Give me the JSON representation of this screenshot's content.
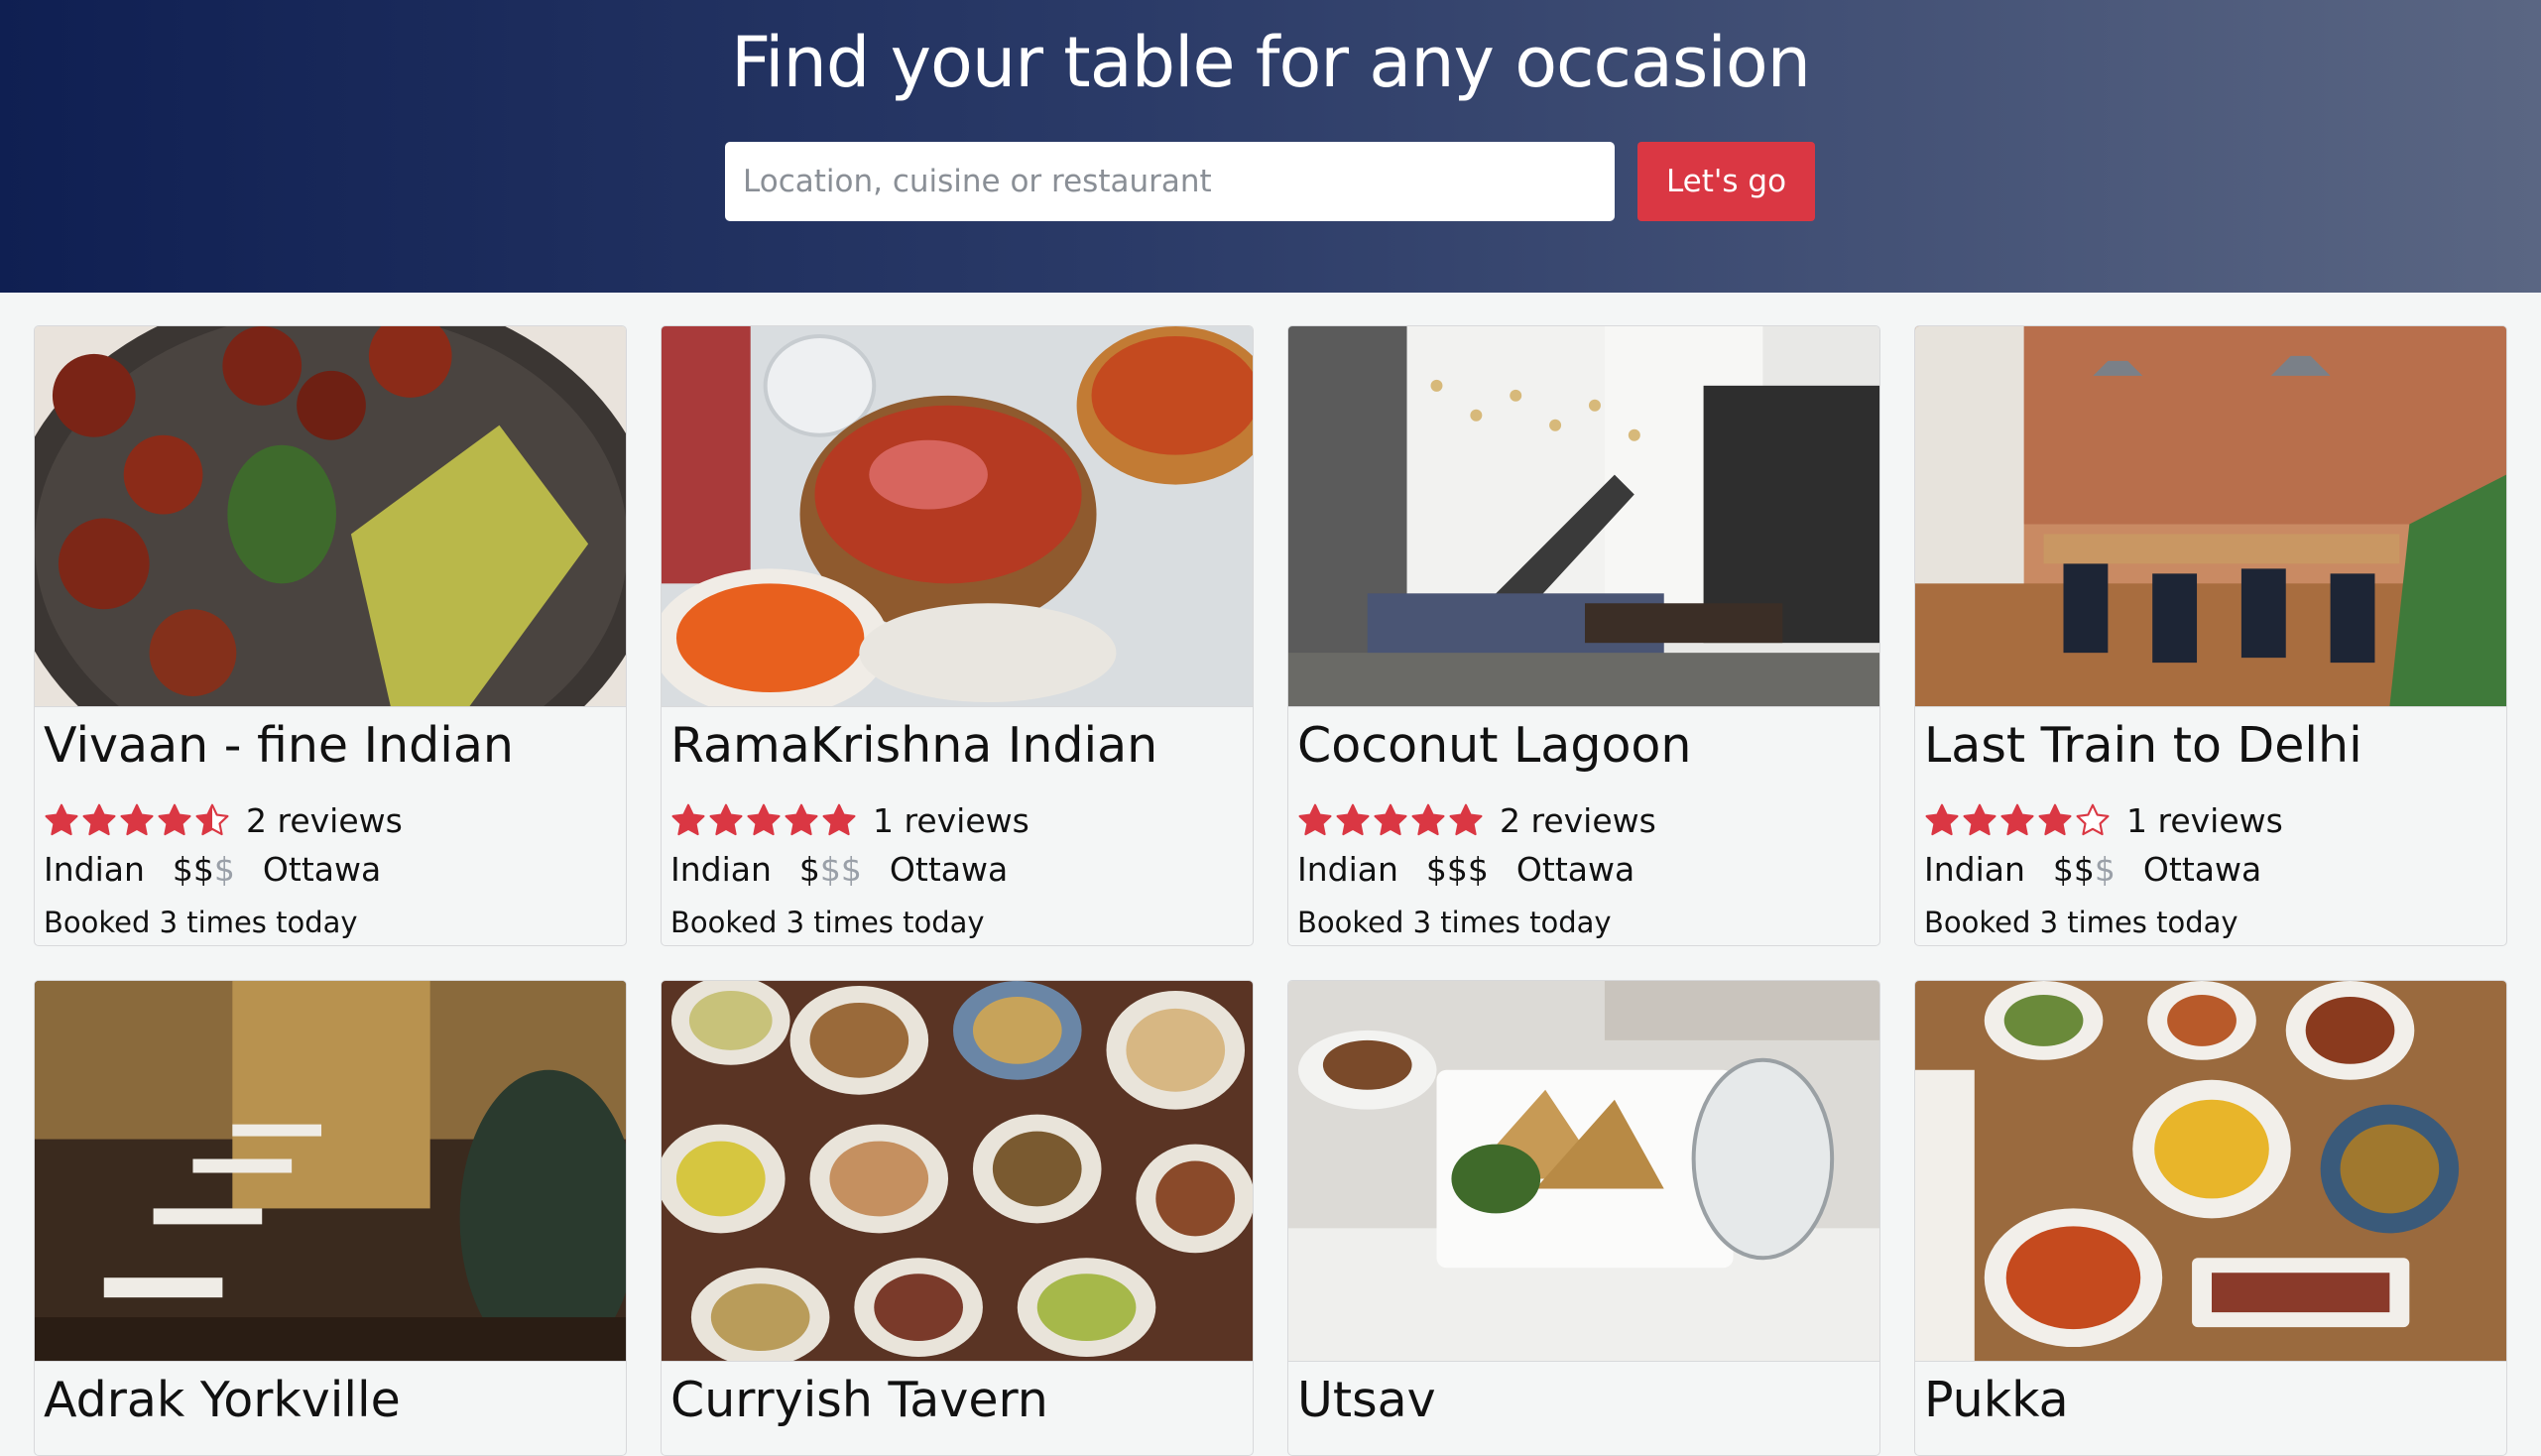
{
  "hero": {
    "title": "Find your table for any occasion",
    "search_placeholder": "Location, cuisine or restaurant",
    "go_label": "Let's go"
  },
  "colors": {
    "brand_red": "#da3743",
    "hero_gradient_start": "#0f1f52",
    "hero_gradient_end": "#5a6683"
  },
  "restaurants": [
    {
      "name": "Vivaan - fine Indian",
      "rating": 4.5,
      "reviews": "2 reviews",
      "cuisine": "Indian",
      "price_on": "$$",
      "price_off": "$",
      "location": "Ottawa",
      "booked": "Booked 3 times today"
    },
    {
      "name": "RamaKrishna Indian",
      "rating": 5,
      "reviews": "1 reviews",
      "cuisine": "Indian",
      "price_on": "$",
      "price_off": "$$",
      "location": "Ottawa",
      "booked": "Booked 3 times today"
    },
    {
      "name": "Coconut Lagoon",
      "rating": 5,
      "reviews": "2 reviews",
      "cuisine": "Indian",
      "price_on": "$$$",
      "price_off": "",
      "location": "Ottawa",
      "booked": "Booked 3 times today"
    },
    {
      "name": "Last Train to Delhi",
      "rating": 4,
      "reviews": "1 reviews",
      "cuisine": "Indian",
      "price_on": "$$",
      "price_off": "$",
      "location": "Ottawa",
      "booked": "Booked 3 times today"
    },
    {
      "name": "Adrak Yorkville"
    },
    {
      "name": "Curryish Tavern"
    },
    {
      "name": "Utsav"
    },
    {
      "name": "Pukka"
    }
  ]
}
